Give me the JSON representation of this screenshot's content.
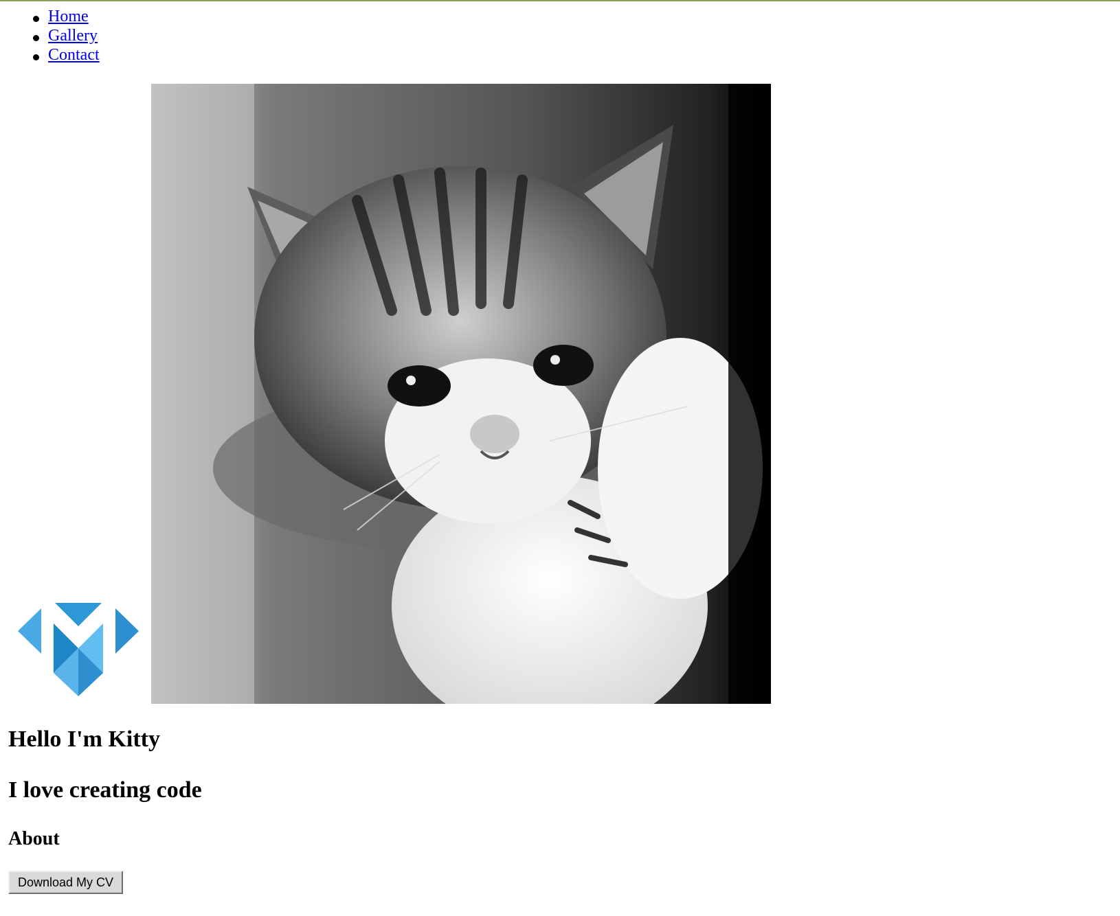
{
  "nav": {
    "items": [
      {
        "label": "Home"
      },
      {
        "label": "Gallery"
      },
      {
        "label": "Contact"
      }
    ]
  },
  "logo": {
    "colors": [
      "#4aa8e4",
      "#2d8fd0",
      "#1f7fc3",
      "#62bdf0"
    ]
  },
  "hero_image": {
    "subject": "black-and-white kitten photo"
  },
  "heading": {
    "title": "Hello I'm Kitty",
    "subtitle": "I love creating code",
    "section": "About"
  },
  "cv_button": {
    "label": "Download My CV"
  }
}
